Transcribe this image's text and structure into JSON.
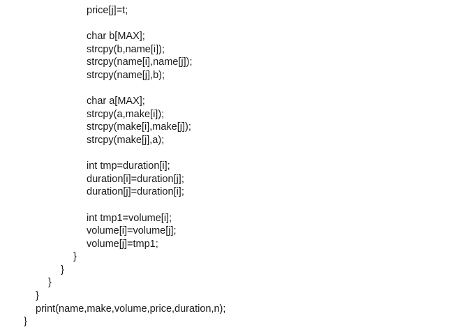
{
  "code": {
    "lines": [
      {
        "indent": 5,
        "text": "price[j]=t;"
      },
      {
        "indent": 5,
        "text": ""
      },
      {
        "indent": 5,
        "text": "char b[MAX];"
      },
      {
        "indent": 5,
        "text": "strcpy(b,name[i]);"
      },
      {
        "indent": 5,
        "text": "strcpy(name[i],name[j]);"
      },
      {
        "indent": 5,
        "text": "strcpy(name[j],b);"
      },
      {
        "indent": 5,
        "text": ""
      },
      {
        "indent": 5,
        "text": "char a[MAX];"
      },
      {
        "indent": 5,
        "text": "strcpy(a,make[i]);"
      },
      {
        "indent": 5,
        "text": "strcpy(make[i],make[j]);"
      },
      {
        "indent": 5,
        "text": "strcpy(make[j],a);"
      },
      {
        "indent": 5,
        "text": ""
      },
      {
        "indent": 5,
        "text": "int tmp=duration[i];"
      },
      {
        "indent": 5,
        "text": "duration[i]=duration[j];"
      },
      {
        "indent": 5,
        "text": "duration[j]=duration[i];"
      },
      {
        "indent": 5,
        "text": ""
      },
      {
        "indent": 5,
        "text": "int tmp1=volume[i];"
      },
      {
        "indent": 5,
        "text": "volume[i]=volume[j];"
      },
      {
        "indent": 5,
        "text": "volume[j]=tmp1;"
      },
      {
        "indent": 4,
        "text": "}"
      },
      {
        "indent": 3,
        "text": "}"
      },
      {
        "indent": 2,
        "text": "}"
      },
      {
        "indent": 1,
        "text": "}"
      },
      {
        "indent": 1,
        "text": "print(name,make,volume,price,duration,n);"
      },
      {
        "indent": 0,
        "text": "}"
      }
    ]
  }
}
